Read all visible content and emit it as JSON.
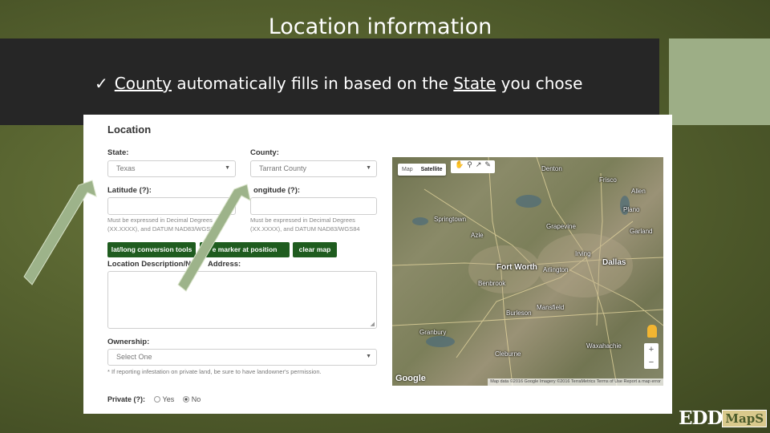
{
  "slide": {
    "title": "Location information",
    "bullet_check": "✓",
    "bullet_word1": "County",
    "bullet_mid": " automatically fills in based on the ",
    "bullet_word2": "State",
    "bullet_end": " you chose"
  },
  "form": {
    "title": "Location",
    "state_label": "State:",
    "state_value": "Texas",
    "county_label": "County:",
    "county_value": "Tarrant County",
    "latitude_label": "Latitude (?):",
    "longitude_label": "ongitude (?):",
    "lat_help": "Must be expressed in Decimal Degrees (XX.XXXX), and DATUM NAD83/WGS8",
    "lon_help": "Must be expressed in Decimal Degrees (XX.XXXX), and DATUM NAD83/WGS84",
    "btn_conversion": "lat/long conversion tools",
    "btn_marker": "e marker at position",
    "btn_clear": "clear map",
    "desc_label_a": "Location Description/Ne",
    "desc_label_b": "Address:",
    "ownership_label": "Ownership:",
    "ownership_value": "Select One",
    "ownership_note": "* If reporting infestation on private land, be sure to have landowner's permission.",
    "private_label": "Private (?):",
    "private_yes": "Yes",
    "private_no": "No",
    "private_selected": "No"
  },
  "map": {
    "type_map": "Map",
    "type_satellite": "Satellite",
    "active_type": "Satellite",
    "cities": {
      "denton": "Denton",
      "frisco": "Frisco",
      "allen": "Allen",
      "plano": "Plano",
      "garland": "Garland",
      "grapevine": "Grapevine",
      "irving": "Irving",
      "dallas": "Dallas",
      "fort_worth": "Fort Worth",
      "arlington": "Arlington",
      "benbrook": "Benbrook",
      "springtown": "Springtown",
      "azle": "Azle",
      "mansfield": "Mansfield",
      "burleson": "Burleson",
      "cleburne": "Cleburne",
      "waxahachie": "Waxahachie",
      "granbury": "Granbury"
    },
    "zoom_in": "+",
    "zoom_out": "−",
    "google": "Google",
    "attribution": "Map data ©2016 Google Imagery ©2016 TerraMetrics   Terms of Use   Report a map error"
  },
  "logo": {
    "edd": "EDD",
    "maps": "MapS"
  }
}
